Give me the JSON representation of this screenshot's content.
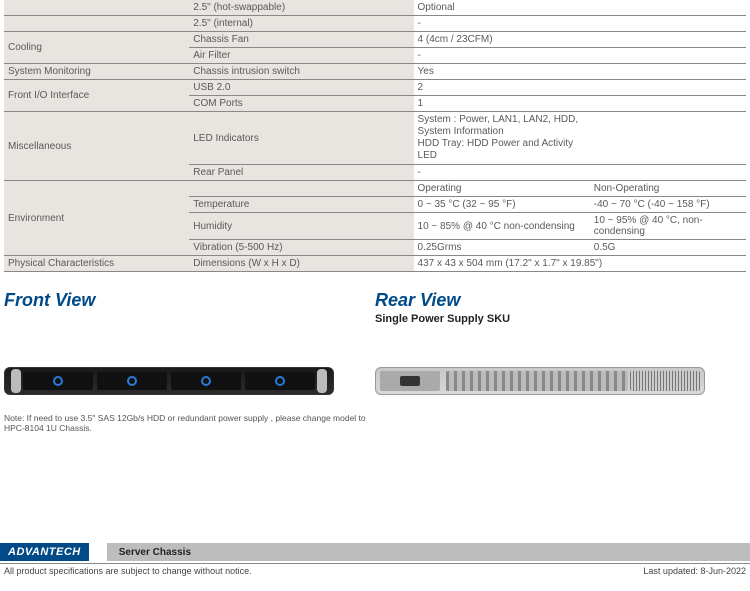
{
  "spec_rows": [
    {
      "c1": "",
      "c2": "2.5\" (hot-swappable)",
      "c3": "Optional",
      "c4": "",
      "top": false
    },
    {
      "c1": "",
      "c2": "2.5\" (internal)",
      "c3": "-",
      "c4": ""
    },
    {
      "c1": "Cooling",
      "c2": "Chassis Fan",
      "c3": "4 (4cm / 23CFM)",
      "c4": "",
      "rowspan": 2
    },
    {
      "c1": null,
      "c2": "Air Filter",
      "c3": "-",
      "c4": ""
    },
    {
      "c1": "System Monitoring",
      "c2": "Chassis intrusion switch",
      "c3": "Yes",
      "c4": ""
    },
    {
      "c1": "Front I/O Interface",
      "c2": "USB 2.0",
      "c3": "2",
      "c4": "",
      "rowspan": 2
    },
    {
      "c1": null,
      "c2": "COM Ports",
      "c3": "1",
      "c4": ""
    },
    {
      "c1": "Miscellaneous",
      "c2": "LED Indicators",
      "c3": "System : Power, LAN1, LAN2, HDD, System Information\nHDD Tray: HDD Power and Activity LED",
      "c4": "",
      "rowspan": 2,
      "tall": true
    },
    {
      "c1": null,
      "c2": "Rear Panel",
      "c3": "-",
      "c4": ""
    },
    {
      "c1": "Environment",
      "c2": "",
      "c3": "Operating",
      "c4": "Non-Operating",
      "rowspan": 4
    },
    {
      "c1": null,
      "c2": "Temperature",
      "c3": "0 ~ 35 °C (32 ~ 95 °F)",
      "c4": "-40 ~ 70 °C (-40 ~ 158 °F)"
    },
    {
      "c1": null,
      "c2": "Humidity",
      "c3": "10 ~ 85% @ 40 °C non-condensing",
      "c4": "10 ~ 95% @ 40 °C, non-condensing"
    },
    {
      "c1": null,
      "c2": "Vibration (5-500 Hz)",
      "c3": "0.25Grms",
      "c4": "0.5G"
    },
    {
      "c1": "Physical Characteristics",
      "c2": "Dimensions (W x H x D)",
      "c3": "437 x 43 x 504 mm (17.2\" x 1.7\" x 19.85\")",
      "c4": "",
      "span34": true
    }
  ],
  "views": {
    "front_title": "Front View",
    "rear_title": "Rear View",
    "rear_sub": "Single Power Supply SKU"
  },
  "note": "Note: If need to use 3.5\" SAS 12Gb/s HDD or redundant power supply , please change model to HPC-8104 1U Chassis.",
  "footer": {
    "brand": "ADVANTECH",
    "category": "Server Chassis",
    "disclaimer": "All product specifications are subject to change without notice.",
    "updated": "Last updated: 8-Jun-2022"
  }
}
